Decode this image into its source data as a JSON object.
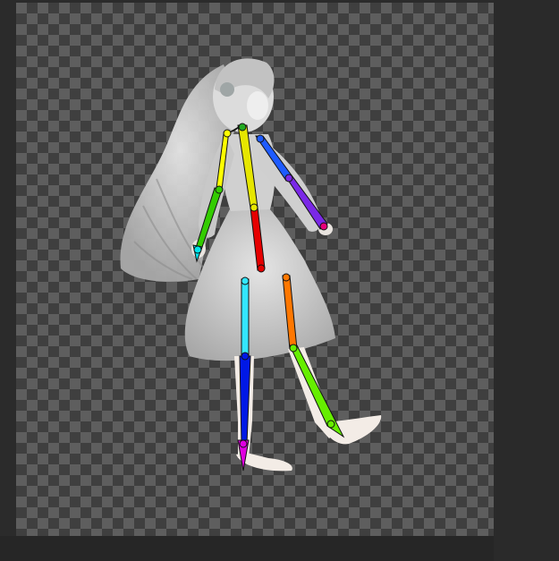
{
  "app": {
    "view": "pose-editor-canvas"
  },
  "canvas": {
    "background": "transparency-checkerboard",
    "checker_light": "#5e5e5e",
    "checker_dark": "#3f3f3f"
  },
  "figure": {
    "subject": "character-in-grey-dress-walking",
    "hair_color": "#cfcfcf",
    "dress_color": "#d6d6d6",
    "skin_color": "#f3ece6"
  },
  "skeleton": {
    "bones": [
      {
        "name": "neck-to-right-shoulder",
        "color": "#ffff00"
      },
      {
        "name": "right-upper-arm",
        "color": "#33cc00"
      },
      {
        "name": "right-forearm",
        "color": "#00e5ee"
      },
      {
        "name": "neck-to-left-shoulder",
        "color": "#1e5bff"
      },
      {
        "name": "left-upper-arm",
        "color": "#7a28e6"
      },
      {
        "name": "torso-upper",
        "color": "#e6e600"
      },
      {
        "name": "torso-lower",
        "color": "#e60000"
      },
      {
        "name": "right-thigh",
        "color": "#33e6ff"
      },
      {
        "name": "right-shin",
        "color": "#0018e6"
      },
      {
        "name": "left-thigh",
        "color": "#ff7700"
      },
      {
        "name": "left-shin",
        "color": "#66ee00"
      }
    ],
    "joints": [
      "neck",
      "right-shoulder",
      "right-elbow",
      "right-wrist",
      "left-shoulder",
      "left-elbow",
      "left-wrist",
      "hip",
      "right-hip",
      "right-knee",
      "right-ankle",
      "left-hip",
      "left-knee",
      "left-ankle"
    ]
  }
}
